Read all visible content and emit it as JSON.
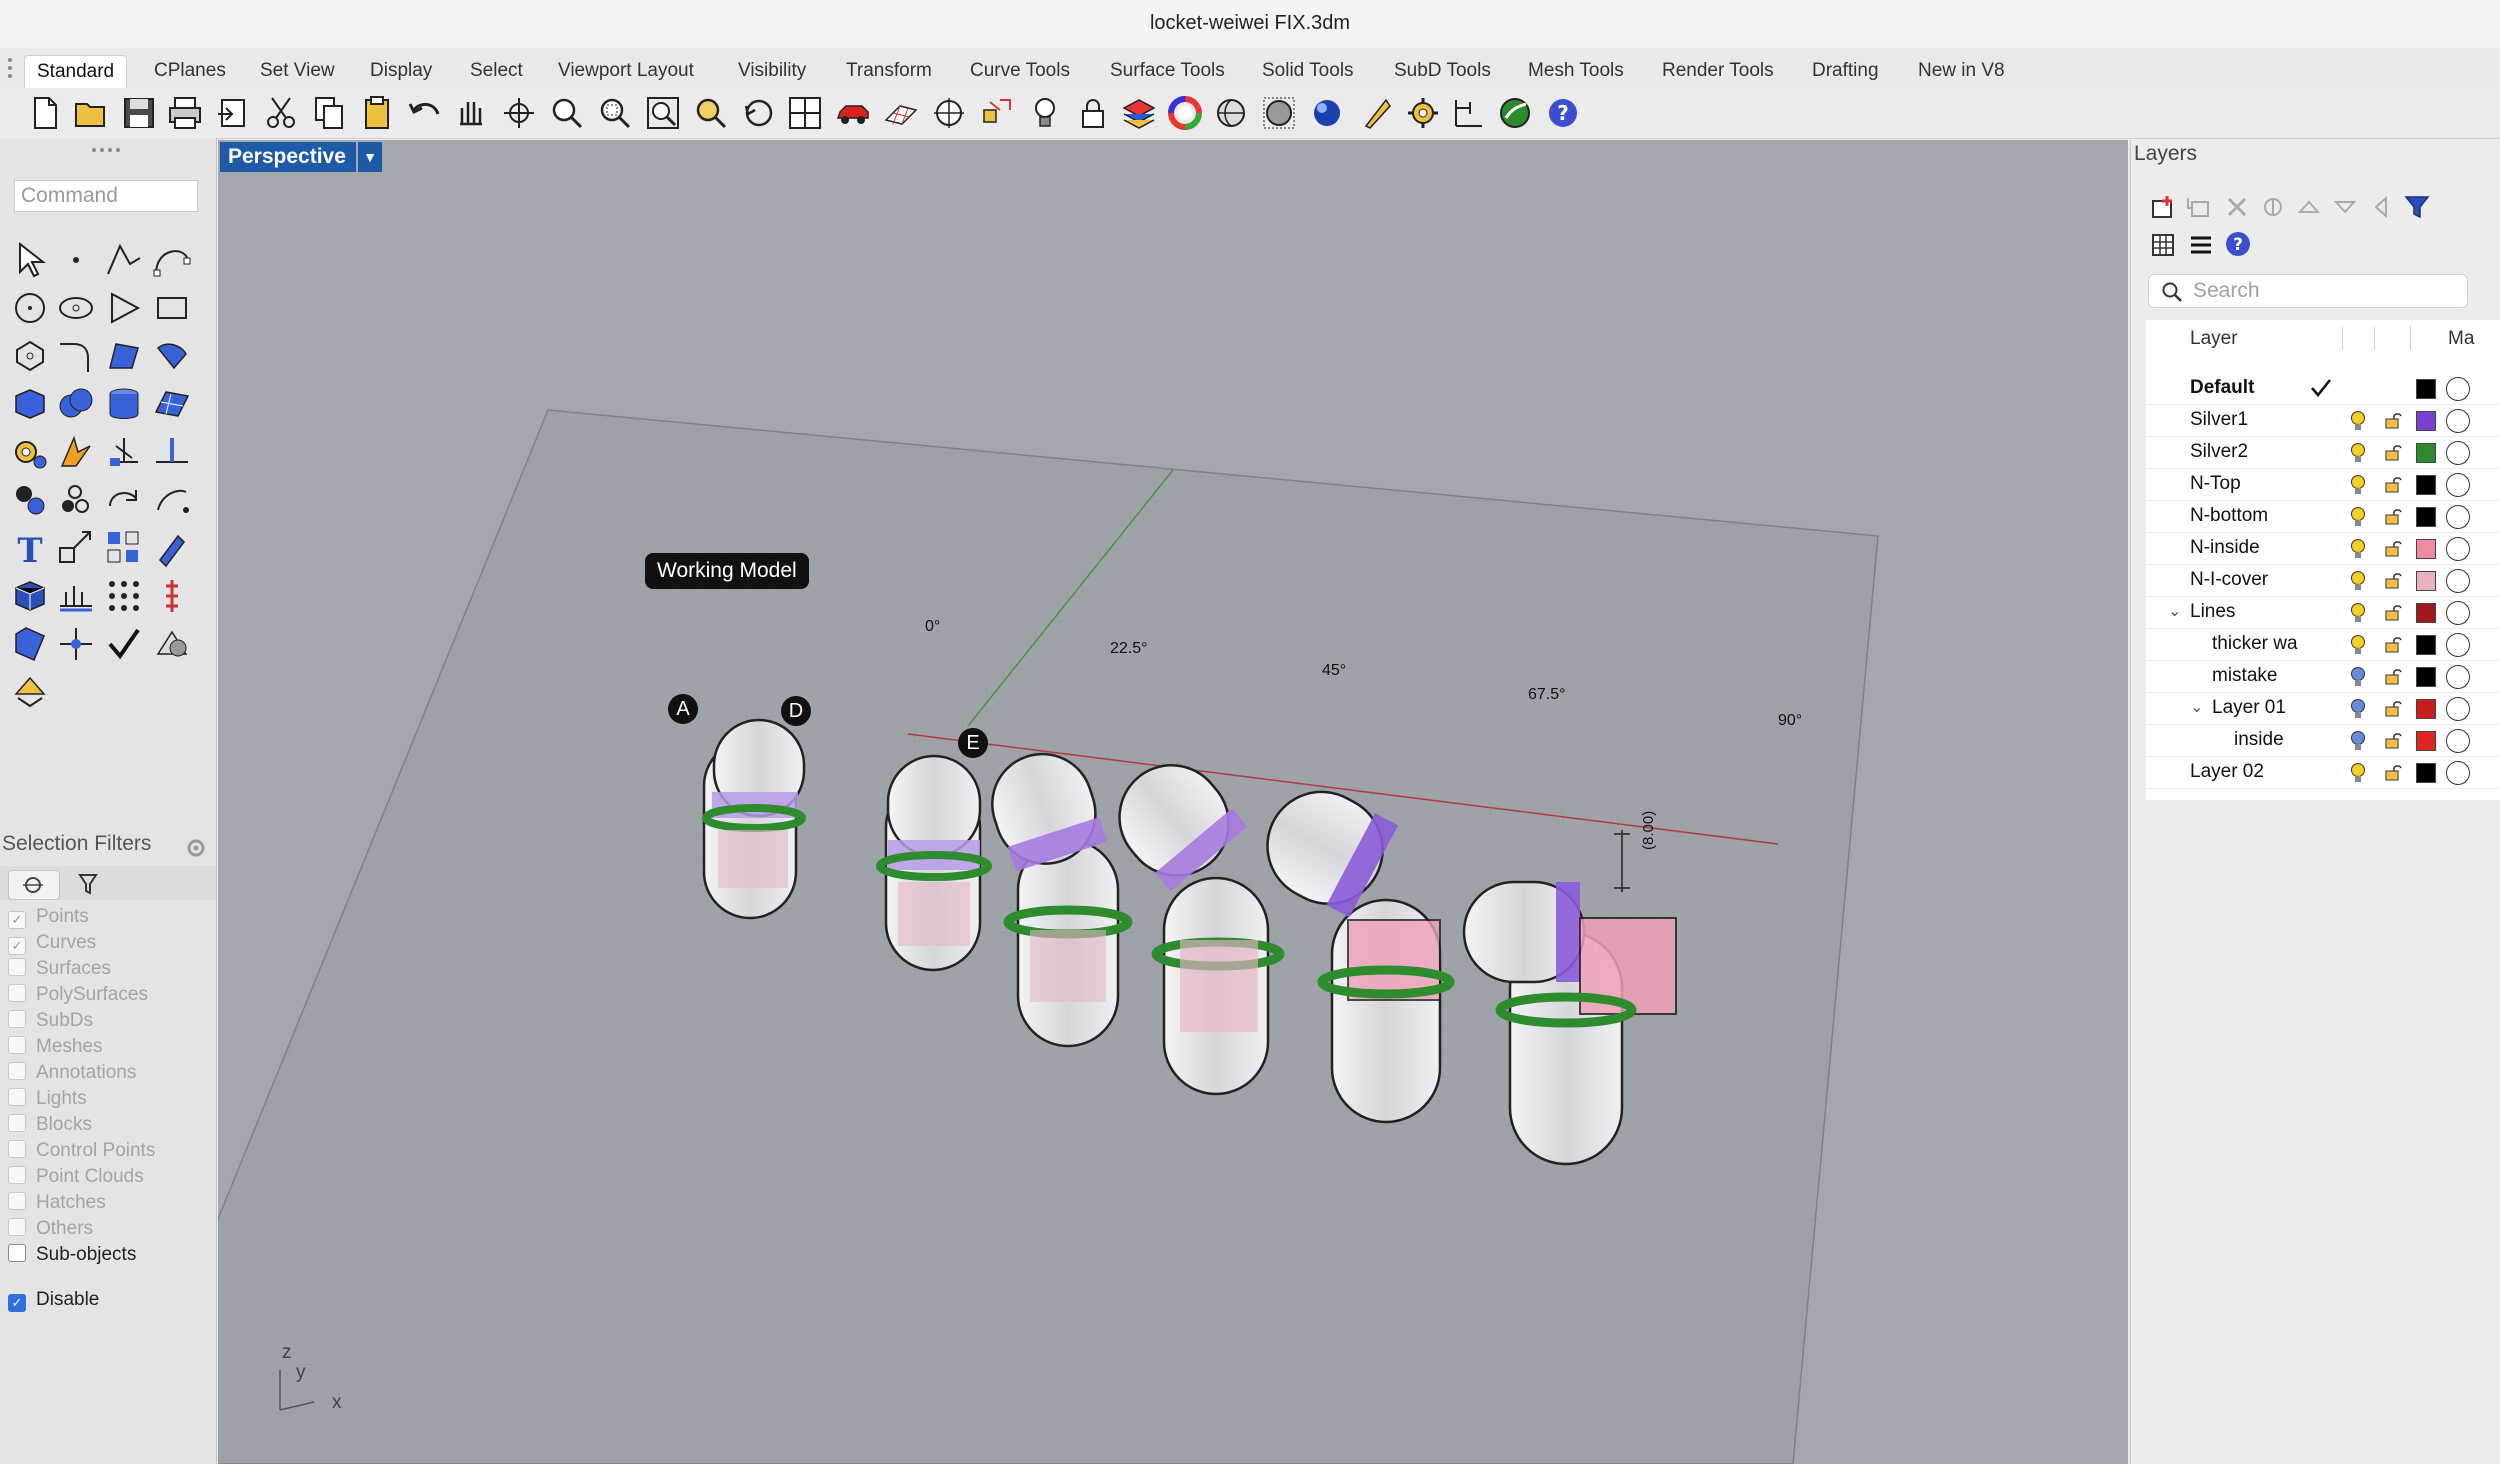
{
  "window": {
    "title": "locket-weiwei FIX.3dm"
  },
  "tabs": [
    "Standard",
    "CPlanes",
    "Set View",
    "Display",
    "Select",
    "Viewport Layout",
    "Visibility",
    "Transform",
    "Curve Tools",
    "Surface Tools",
    "Solid Tools",
    "SubD Tools",
    "Mesh Tools",
    "Render Tools",
    "Drafting",
    "New in V8"
  ],
  "command": {
    "placeholder": "Command"
  },
  "viewport": {
    "name": "Perspective",
    "label": "Working Model",
    "angles": [
      "0°",
      "22.5°",
      "45°",
      "67.5°",
      "90°"
    ],
    "markers": [
      "A",
      "D",
      "E"
    ],
    "dimension": "(8.00)",
    "axis_labels": {
      "z": "z",
      "y": "y",
      "x": "x"
    }
  },
  "selection_filters": {
    "title": "Selection Filters",
    "items": [
      {
        "label": "Points",
        "checked": true
      },
      {
        "label": "Curves",
        "checked": true
      },
      {
        "label": "Surfaces",
        "checked": false
      },
      {
        "label": "PolySurfaces",
        "checked": false
      },
      {
        "label": "SubDs",
        "checked": false
      },
      {
        "label": "Meshes",
        "checked": false
      },
      {
        "label": "Annotations",
        "checked": false
      },
      {
        "label": "Lights",
        "checked": false
      },
      {
        "label": "Blocks",
        "checked": false
      },
      {
        "label": "Control Points",
        "checked": false
      },
      {
        "label": "Point Clouds",
        "checked": false
      },
      {
        "label": "Hatches",
        "checked": false
      },
      {
        "label": "Others",
        "checked": false
      },
      {
        "label": "Sub-objects",
        "checked": false
      }
    ],
    "disable": {
      "label": "Disable",
      "checked": true
    }
  },
  "layers": {
    "title": "Layers",
    "search_placeholder": "Search",
    "header": {
      "layer": "Layer",
      "material": "Ma"
    },
    "rows": [
      {
        "name": "Default",
        "current": true,
        "color": "#000000"
      },
      {
        "name": "Silver1",
        "color": "#7a3fd0"
      },
      {
        "name": "Silver2",
        "color": "#2f8a2f"
      },
      {
        "name": "N-Top",
        "color": "#000000"
      },
      {
        "name": "N-bottom",
        "color": "#000000"
      },
      {
        "name": "N-inside",
        "color": "#f08aa0"
      },
      {
        "name": "N-I-cover",
        "color": "#eab2bd"
      },
      {
        "name": "Lines",
        "color": "#a01818",
        "expanded": true
      },
      {
        "name": "thicker wa",
        "color": "#000000"
      },
      {
        "name": "mistake",
        "color": "#000000"
      },
      {
        "name": "Layer 01",
        "color": "#c81e1e",
        "expanded": true
      },
      {
        "name": "inside",
        "color": "#e02424"
      },
      {
        "name": "Layer 02",
        "color": "#000000"
      }
    ]
  }
}
